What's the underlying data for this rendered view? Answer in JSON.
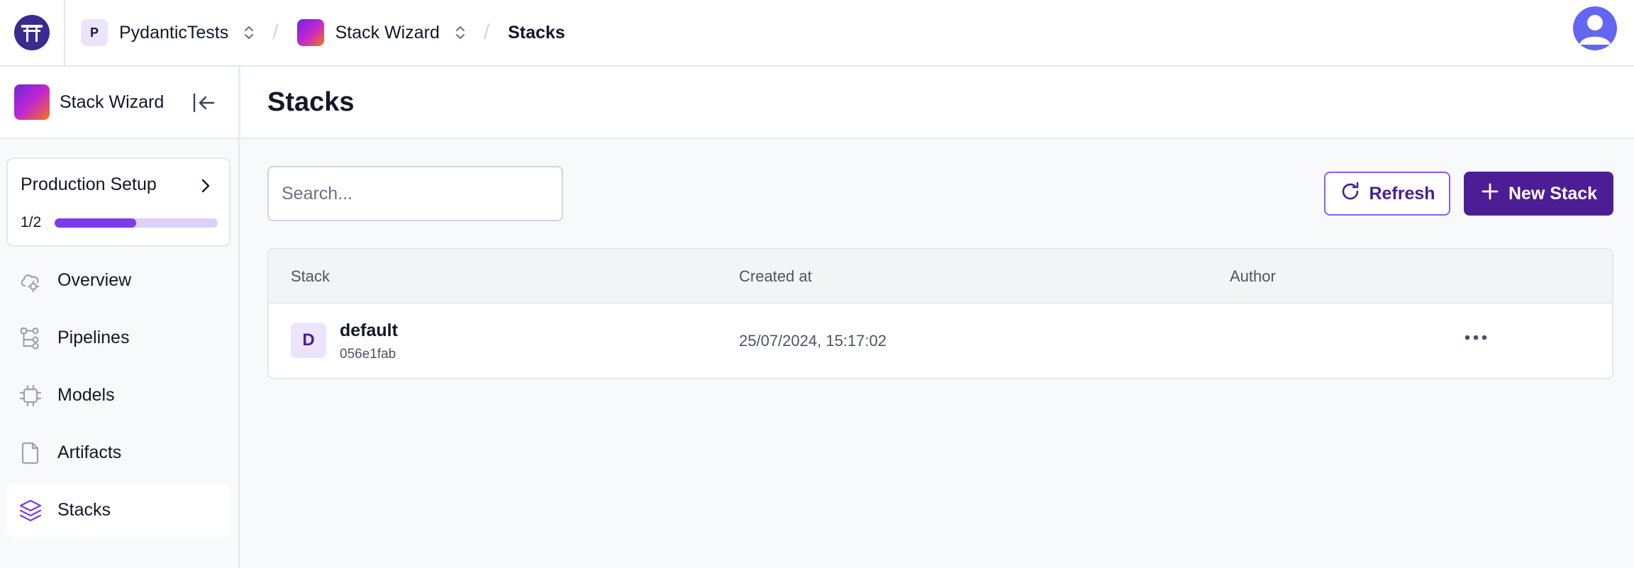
{
  "topbar": {
    "workspace_initial": "P",
    "workspace_name": "PydanticTests",
    "project_name": "Stack Wizard",
    "current_page": "Stacks"
  },
  "sidebar": {
    "project_name": "Stack Wizard",
    "setup": {
      "title": "Production Setup",
      "count_label": "1/2",
      "progress_fraction": 0.5
    },
    "items": [
      {
        "label": "Overview",
        "icon": "cloud-cog-icon",
        "active": false
      },
      {
        "label": "Pipelines",
        "icon": "pipeline-tree-icon",
        "active": false
      },
      {
        "label": "Models",
        "icon": "chip-icon",
        "active": false
      },
      {
        "label": "Artifacts",
        "icon": "file-icon",
        "active": false
      },
      {
        "label": "Stacks",
        "icon": "layers-icon",
        "active": true
      }
    ]
  },
  "main": {
    "title": "Stacks",
    "search": {
      "placeholder": "Search...",
      "value": ""
    },
    "refresh_label": "Refresh",
    "new_label": "New Stack",
    "table": {
      "columns": [
        "Stack",
        "Created at",
        "Author"
      ],
      "rows": [
        {
          "initial": "D",
          "name": "default",
          "id": "056e1fab",
          "created_at": "25/07/2024, 15:17:02",
          "author": ""
        }
      ]
    }
  },
  "colors": {
    "brand": "#4c1d95",
    "accent": "#7c3aed",
    "badge_bg": "#ece4fd"
  }
}
